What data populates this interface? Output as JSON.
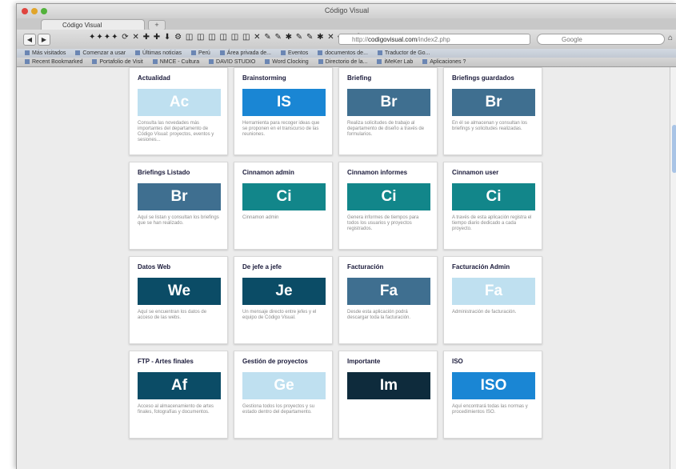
{
  "window": {
    "title": "Código Visual"
  },
  "tabs": [
    {
      "label": "Código Visual"
    }
  ],
  "newtab_label": "+",
  "nav": {
    "back": "◀",
    "forward": "▶",
    "home": "⌂"
  },
  "devtools_icons": "✦✦✦✦ ⟳ ✕ ✚ ✚ ⬇ ⚙ ◫ ◫ ◫ ◫ ◫ ◫ ✕ ✎ ✎ ✱ ✎ ✎ ✱ ✕ ━ ━ ✚ ⟳ ✎",
  "address": {
    "prefix": "http://",
    "domain": "codigovisual.com",
    "path": "/index2.php"
  },
  "search": {
    "placeholder": "Google"
  },
  "bookmarks_row1": [
    "Más visitados",
    "Comenzar a usar",
    "Últimas noticias",
    "Perú",
    "Área privada de...",
    "Eventos",
    "documentos de...",
    "Traductor de Go..."
  ],
  "bookmarks_row2": [
    "Recent Bookmarked",
    "Portafolio de Visit",
    "NMCE - Cultura",
    "DAVID STUDIO",
    "Word Clocking",
    "Directorio de la...",
    "iMeKer Lab",
    "Aplicaciones ?"
  ],
  "colors": {
    "light_blue": "#bfe0f0",
    "blue": "#1a86d4",
    "steel": "#3f6f90",
    "teal": "#12868a",
    "dark_navy": "#0b4c66",
    "black_navy": "#0e2b3c"
  },
  "cards": [
    {
      "title": "Actualidad",
      "abbr": "Ac",
      "color": "#bfe0f0",
      "desc": "Consulta las novedades más importantes del departamento de Código Visual: proyectos, eventos y sesiones..."
    },
    {
      "title": "Brainstorming",
      "abbr": "IS",
      "color": "#1a86d4",
      "desc": "Herramienta para recoger ideas que se proponen en el transcurso de las reuniones."
    },
    {
      "title": "Briefing",
      "abbr": "Br",
      "color": "#3f6f90",
      "desc": "Realiza solicitudes de trabajo al departamento de diseño a través de formularios."
    },
    {
      "title": "Briefings guardados",
      "abbr": "Br",
      "color": "#3f6f90",
      "desc": "En él se almacenan y consultan los briefings y solicitudes realizadas."
    },
    {
      "title": "Briefings Listado",
      "abbr": "Br",
      "color": "#3f6f90",
      "desc": "Aquí se listan y consultan los briefings que se han realizado."
    },
    {
      "title": "Cinnamon admin",
      "abbr": "Ci",
      "color": "#12868a",
      "desc": "Cinnamon admin"
    },
    {
      "title": "Cinnamon informes",
      "abbr": "Ci",
      "color": "#12868a",
      "desc": "Genera informes de tiempos para todos los usuarios y proyectos registrados."
    },
    {
      "title": "Cinnamon user",
      "abbr": "Ci",
      "color": "#12868a",
      "desc": "A través de esta aplicación registra el tiempo diario dedicado a cada proyecto."
    },
    {
      "title": "Datos Web",
      "abbr": "We",
      "color": "#0b4c66",
      "desc": "Aquí se encuentran los datos de acceso de las webs."
    },
    {
      "title": "De jefe a jefe",
      "abbr": "Je",
      "color": "#0b4c66",
      "desc": "Un mensaje directo entre jefes y el equipo de Código Visual."
    },
    {
      "title": "Facturación",
      "abbr": "Fa",
      "color": "#3f6f90",
      "desc": "Desde esta aplicación podrá descargar toda la facturación."
    },
    {
      "title": "Facturación Admin",
      "abbr": "Fa",
      "color": "#bfe0f0",
      "desc": "Administración de facturación."
    },
    {
      "title": "FTP - Artes finales",
      "abbr": "Af",
      "color": "#0b4c66",
      "desc": "Acceso al almacenamiento de artes finales, fotografías y documentos."
    },
    {
      "title": "Gestión de proyectos",
      "abbr": "Ge",
      "color": "#bfe0f0",
      "desc": "Gestiona todos los proyectos y su estado dentro del departamento."
    },
    {
      "title": "Importante",
      "abbr": "Im",
      "color": "#0e2b3c",
      "desc": ""
    },
    {
      "title": "ISO",
      "abbr": "ISO",
      "color": "#1a86d4",
      "desc": "Aquí encontrará todas las normas y procedimientos ISO."
    }
  ]
}
